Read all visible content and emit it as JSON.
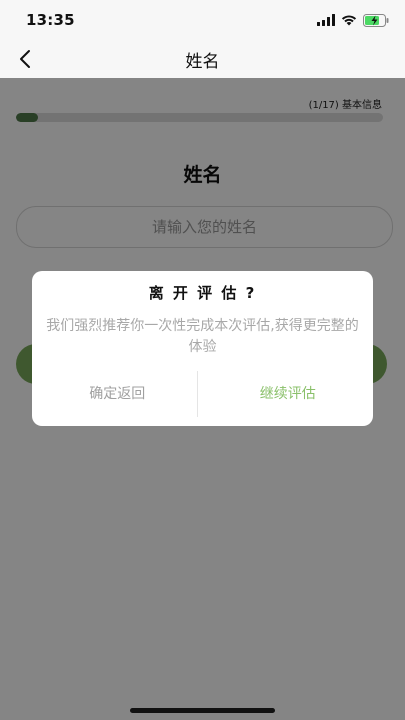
{
  "status_bar": {
    "time": "13:35"
  },
  "nav": {
    "title": "姓名"
  },
  "progress": {
    "label": "(1/17) 基本信息",
    "fraction": 0.06
  },
  "form": {
    "section_title": "姓名",
    "name_placeholder": "请输入您的姓名"
  },
  "dialog": {
    "title": "离 开 评 估 ?",
    "message": "我们强烈推荐你一次性完成本次评估,获得更完整的体验",
    "confirm_label": "确定返回",
    "continue_label": "继续评估"
  },
  "colors": {
    "accent": "#7aaa5a",
    "progress": "#4f7a4a",
    "continue": "#8ac06a",
    "battery": "#4cd964"
  },
  "icons": [
    "back-arrow-icon",
    "signal-icon",
    "wifi-icon",
    "battery-charging-icon"
  ]
}
